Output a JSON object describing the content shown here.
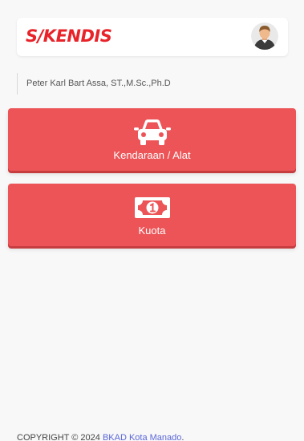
{
  "header": {
    "logo_text": "S/KENDIS",
    "avatar_icon": "user-avatar-icon"
  },
  "user": {
    "name": "Peter Karl Bart Assa, ST.,M.Sc.,Ph.D"
  },
  "menu": [
    {
      "label": "Kendaraan / Alat",
      "icon": "car-icon"
    },
    {
      "label": "Kuota",
      "icon": "money-icon"
    }
  ],
  "footer": {
    "prefix": "COPYRIGHT © 2024 ",
    "link_text": "BKAD Kota Manado",
    "suffix": "."
  },
  "colors": {
    "brand_red": "#e8232a",
    "tile_red": "#ec5457",
    "link": "#5a67d8"
  }
}
